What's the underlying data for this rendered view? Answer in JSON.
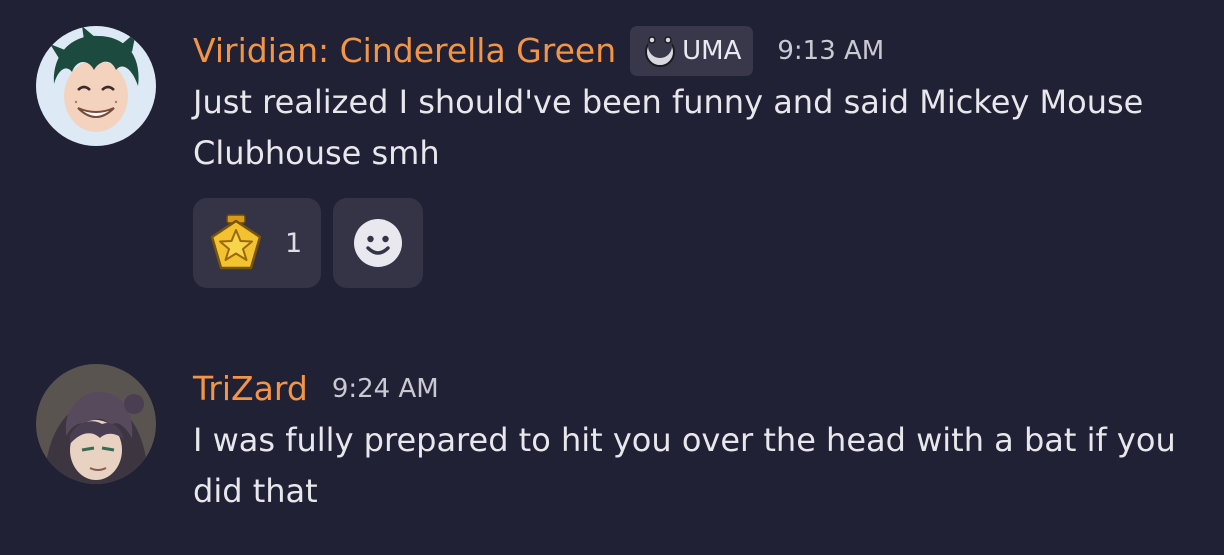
{
  "messages": [
    {
      "username": "Viridian: Cinderella Green",
      "role_tag": {
        "label": "UMA",
        "icon": "crescent-moon-icon"
      },
      "timestamp": "9:13 AM",
      "text": "Just realized I should've been funny and said Mickey Mouse Clubhouse smh",
      "reactions": [
        {
          "emoji": "gold-star-badge",
          "count": "1"
        }
      ],
      "add_reaction_icon": "smiley-icon"
    },
    {
      "username": "TriZard",
      "timestamp": "9:24 AM",
      "text": "I was fully prepared to hit you over the head with a bat if you did that"
    }
  ],
  "colors": {
    "background": "#212136",
    "username": "#f49445",
    "text": "#e7e7ec",
    "timestamp": "#c9c9d2",
    "chip": "#343446"
  }
}
